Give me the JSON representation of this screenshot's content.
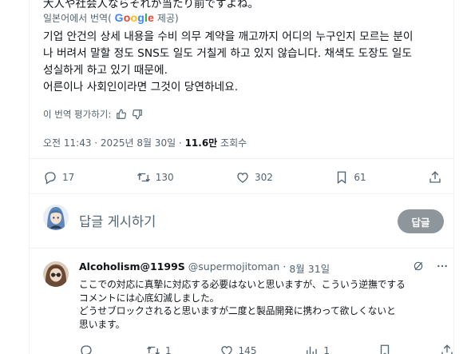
{
  "tweet": {
    "clipped_original": "大人や社会人ならそれが当たり前ですよね。",
    "translated_from": "일본어에서 번역(",
    "google_letters": [
      "G",
      "o",
      "o",
      "g",
      "l",
      "e"
    ],
    "provided": "제공)",
    "body_lines": [
      "기업 안건의 상세 내용을 수비 의무 계약을 깨고까지 어디의 누구인지 모르는 분이",
      "나 버려서 말할 정도 SNS도 일도 거칠게 하고 있지 않습니다. 채색도 도장도 일도",
      "성실하게 하고 있기 때문에.",
      "어른이나 사회인이라면 그것이 당연하네요."
    ],
    "rate_translation": "이 번역 평가하기:",
    "timestamp": "오전 11:43 · 2025년 8월 30일 · ",
    "views_count": "11.6만",
    "views_label": " 조회수",
    "actions": {
      "replies": "17",
      "reposts": "130",
      "likes": "302",
      "bookmarks": "61"
    }
  },
  "reply_composer": {
    "placeholder": "답글 게시하기",
    "button": "답글"
  },
  "reply": {
    "display_name": "Alcoholism@1199S",
    "handle": "@supermojitoman",
    "separator": "·",
    "date": "8월 31일",
    "lines": [
      "ここでの対応に真摯に対応する必要はないと思いますが、こういう逆撫でする",
      "コメントには心底幻滅しました。",
      "どうせブロックされると思いますが二度と製品開発に携わって欲しくないと",
      "思います。"
    ],
    "actions": {
      "replies": "",
      "reposts": "1",
      "likes": "145",
      "views": "1"
    }
  },
  "colors": {
    "text_primary": "#0f1419",
    "text_secondary": "#536471",
    "reply_button_bg": "#8e959b",
    "divider": "#eff3f4"
  },
  "icons": [
    "thumb-up-icon",
    "thumb-down-icon",
    "reply-icon",
    "repost-icon",
    "like-icon",
    "bookmark-icon",
    "share-icon",
    "views-icon",
    "grok-icon",
    "more-icon"
  ]
}
